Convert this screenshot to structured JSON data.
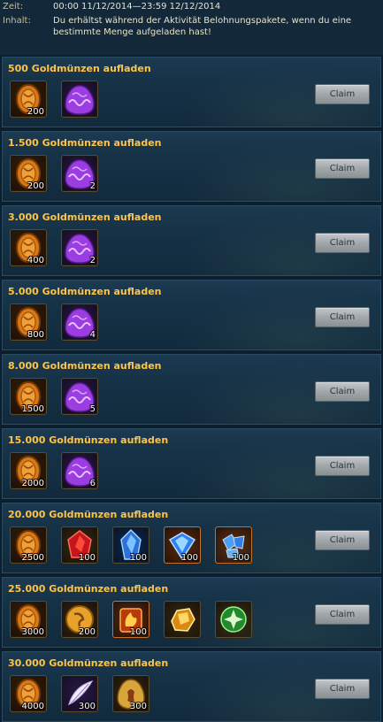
{
  "header": {
    "zeit_label": "Zeit:",
    "zeit_value": "00:00 11/12/2014—23:59 12/12/2014",
    "inhalt_label": "Inhalt:",
    "inhalt_value": "Du erhältst während der Aktivität Belohnungspakete, wenn du eine bestimmte Menge aufgeladen hast!"
  },
  "claim_label": "Claim",
  "rows": [
    {
      "title": "500 Goldmünzen aufladen",
      "items": [
        {
          "icon": "gold-coin",
          "qty": "200"
        },
        {
          "icon": "purple-egg",
          "qty": ""
        }
      ]
    },
    {
      "title": "1.500 Goldmünzen aufladen",
      "items": [
        {
          "icon": "gold-coin",
          "qty": "200"
        },
        {
          "icon": "purple-egg",
          "qty": "2"
        }
      ]
    },
    {
      "title": "3.000 Goldmünzen aufladen",
      "items": [
        {
          "icon": "gold-coin",
          "qty": "400"
        },
        {
          "icon": "purple-egg",
          "qty": "2"
        }
      ]
    },
    {
      "title": "5.000 Goldmünzen aufladen",
      "items": [
        {
          "icon": "gold-coin",
          "qty": "800"
        },
        {
          "icon": "purple-egg",
          "qty": "4"
        }
      ]
    },
    {
      "title": "8.000 Goldmünzen aufladen",
      "items": [
        {
          "icon": "gold-coin",
          "qty": "1500"
        },
        {
          "icon": "purple-egg",
          "qty": "5"
        }
      ]
    },
    {
      "title": "15.000 Goldmünzen aufladen",
      "items": [
        {
          "icon": "gold-coin",
          "qty": "2000"
        },
        {
          "icon": "purple-egg",
          "qty": "6"
        }
      ]
    },
    {
      "title": "20.000 Goldmünzen aufladen",
      "items": [
        {
          "icon": "gold-coin",
          "qty": "2500"
        },
        {
          "icon": "red-crystal",
          "qty": "100"
        },
        {
          "icon": "blue-crystal",
          "qty": "100"
        },
        {
          "icon": "blue-gem",
          "qty": "100"
        },
        {
          "icon": "blue-shards",
          "qty": "100"
        }
      ]
    },
    {
      "title": "25.000 Goldmünzen aufladen",
      "items": [
        {
          "icon": "gold-coin",
          "qty": "3000"
        },
        {
          "icon": "gold-token",
          "qty": "200"
        },
        {
          "icon": "fire-scroll",
          "qty": "100"
        },
        {
          "icon": "amber-stone",
          "qty": ""
        },
        {
          "icon": "green-star",
          "qty": ""
        }
      ]
    },
    {
      "title": "30.000 Goldmünzen aufladen",
      "items": [
        {
          "icon": "gold-coin",
          "qty": "4000"
        },
        {
          "icon": "white-feather",
          "qty": "300"
        },
        {
          "icon": "golden-egg",
          "qty": "300"
        }
      ]
    }
  ]
}
